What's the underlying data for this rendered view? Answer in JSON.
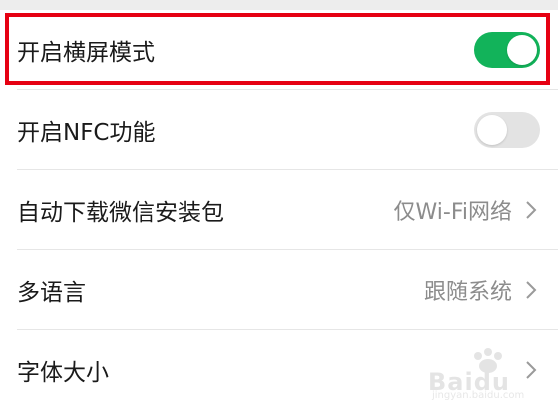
{
  "settings": {
    "items": [
      {
        "label": "开启横屏模式",
        "type": "toggle",
        "on": true
      },
      {
        "label": "开启NFC功能",
        "type": "toggle",
        "on": false
      },
      {
        "label": "自动下载微信安装包",
        "type": "value",
        "value": "仅Wi-Fi网络"
      },
      {
        "label": "多语言",
        "type": "value",
        "value": "跟随系统"
      },
      {
        "label": "字体大小",
        "type": "chevron"
      }
    ]
  },
  "icons": {
    "chevron": "chevron-right-icon"
  },
  "colors": {
    "toggle_on": "#12b35a",
    "toggle_off": "#e3e3e3",
    "highlight": "#e60012",
    "value_text": "#8c8c8c"
  },
  "watermark": {
    "text": "Baidu",
    "sub": "jingyan.baidu.com"
  }
}
